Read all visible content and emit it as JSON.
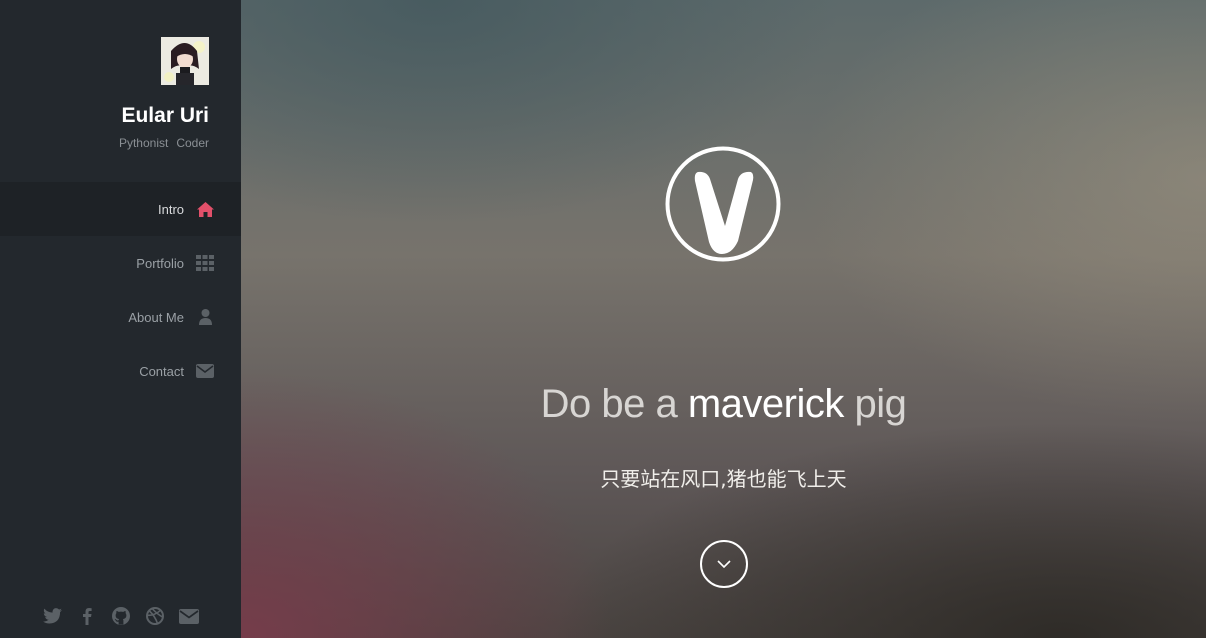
{
  "profile": {
    "name": "Eular Uri",
    "tags": [
      "Pythonist",
      "Coder"
    ]
  },
  "nav": {
    "items": [
      {
        "label": "Intro",
        "icon": "home-icon",
        "active": true
      },
      {
        "label": "Portfolio",
        "icon": "grid-icon",
        "active": false
      },
      {
        "label": "About Me",
        "icon": "user-icon",
        "active": false
      },
      {
        "label": "Contact",
        "icon": "envelope-icon",
        "active": false
      }
    ]
  },
  "social": [
    "twitter-icon",
    "facebook-icon",
    "github-icon",
    "dribbble-icon",
    "envelope-icon"
  ],
  "hero": {
    "headline_part1": "Do be a ",
    "headline_part2": "maverick",
    "headline_part3": " pig",
    "subline": "只要站在风口,猪也能飞上天",
    "logo": "v-logo-icon",
    "scroll_icon": "chevron-down-icon"
  },
  "colors": {
    "sidebar_bg": "#23282d",
    "active_bg": "#1e2226",
    "accent": "#e2506a",
    "muted_icon": "#5b6166"
  }
}
